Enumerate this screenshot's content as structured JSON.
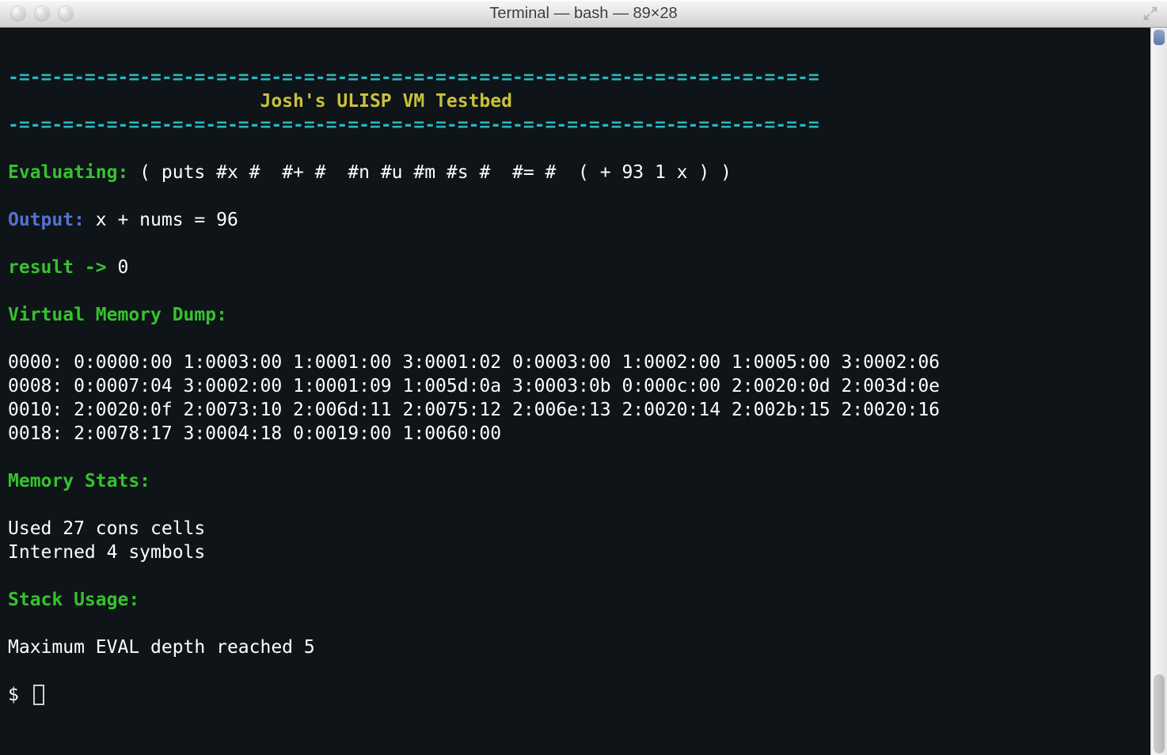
{
  "window": {
    "title": "Terminal — bash — 89×28"
  },
  "banner": {
    "rule": "-=-=-=-=-=-=-=-=-=-=-=-=-=-=-=-=-=-=-=-=-=-=-=-=-=-=-=-=-=-=-=-=-=-=-=-=-=",
    "title_line": "                       Josh's ULISP VM Testbed"
  },
  "eval": {
    "label": "Evaluating:",
    "expr": " ( puts #x #  #+ #  #n #u #m #s #  #= #  ( + 93 1 x ) ) "
  },
  "output": {
    "label": "Output:",
    "value": " x + nums = 96"
  },
  "result": {
    "label": "result ->",
    "value": " 0"
  },
  "sections": {
    "vm_dump": "Virtual Memory Dump:",
    "mem_stats": "Memory Stats:",
    "stack_usage": "Stack Usage:"
  },
  "vm_dump_lines": [
    "0000: 0:0000:00 1:0003:00 1:0001:00 3:0001:02 0:0003:00 1:0002:00 1:0005:00 3:0002:06",
    "0008: 0:0007:04 3:0002:00 1:0001:09 1:005d:0a 3:0003:0b 0:000c:00 2:0020:0d 2:003d:0e",
    "0010: 2:0020:0f 2:0073:10 2:006d:11 2:0075:12 2:006e:13 2:0020:14 2:002b:15 2:0020:16",
    "0018: 2:0078:17 3:0004:18 0:0019:00 1:0060:00"
  ],
  "mem_stats_lines": [
    "Used 27 cons cells",
    "Interned 4 symbols"
  ],
  "stack_usage_lines": [
    "Maximum EVAL depth reached 5"
  ],
  "prompt": "$ "
}
